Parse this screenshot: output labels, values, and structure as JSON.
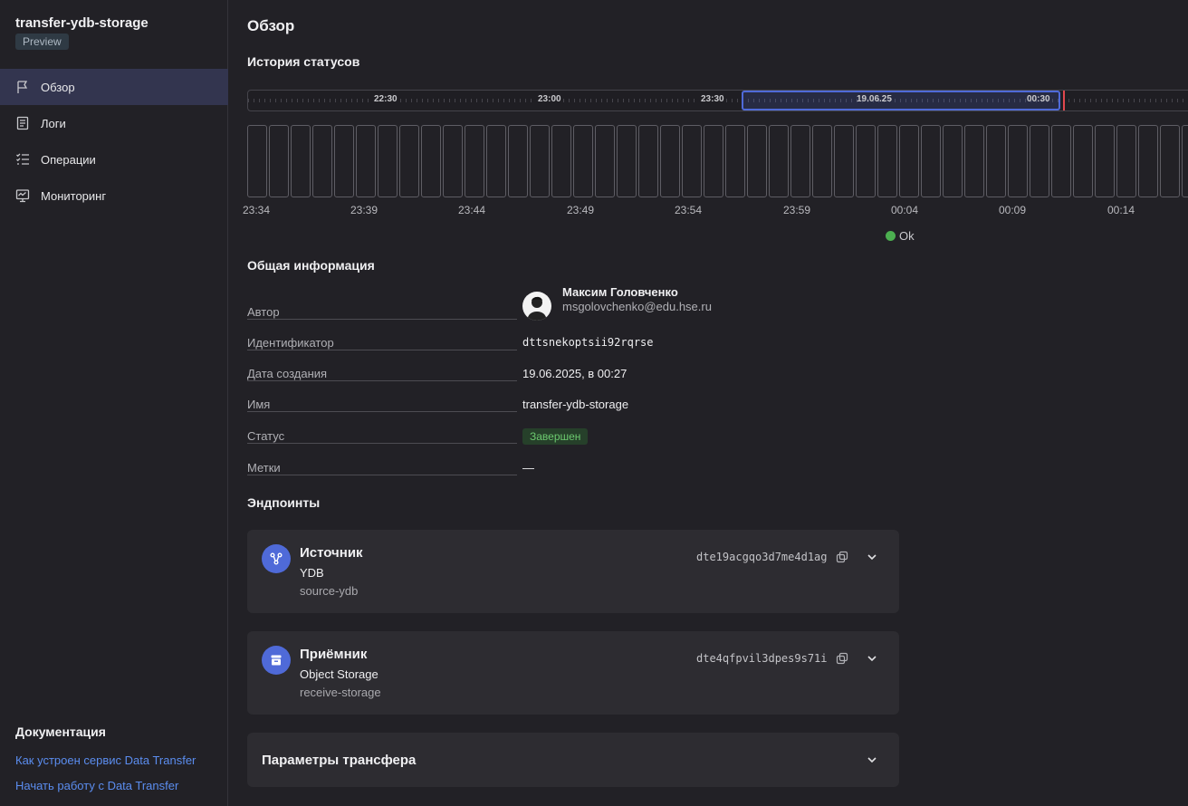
{
  "sidebar": {
    "app_title": "transfer-ydb-storage",
    "badge": "Preview",
    "items": [
      {
        "label": "Обзор",
        "icon": "flag-icon",
        "active": true
      },
      {
        "label": "Логи",
        "icon": "log-icon"
      },
      {
        "label": "Операции",
        "icon": "list-check-icon"
      },
      {
        "label": "Мониторинг",
        "icon": "monitoring-icon"
      }
    ],
    "docs_title": "Документация",
    "docs_links": [
      "Как устроен сервис Data Transfer",
      "Начать работу с Data Transfer"
    ]
  },
  "page": {
    "title": "Обзор",
    "status_history_title": "История статусов",
    "timeline_labels": [
      "22:30",
      "23:00",
      "23:30",
      "19.06.25",
      "00:30"
    ],
    "bar_axis_labels": [
      "23:34",
      "23:39",
      "23:44",
      "23:49",
      "23:54",
      "23:59",
      "00:04",
      "00:09",
      "00:14"
    ],
    "legend_ok": "Ok",
    "general_info_title": "Общая информация",
    "info": {
      "author_label": "Автор",
      "author_name": "Максим Головченко",
      "author_email": "msgolovchenko@edu.hse.ru",
      "id_label": "Идентификатор",
      "id_value": "dttsnekoptsii92rqrse",
      "created_label": "Дата создания",
      "created_value": "19.06.2025, в 00:27",
      "name_label": "Имя",
      "name_value": "transfer-ydb-storage",
      "status_label": "Статус",
      "status_value": "Завершен",
      "tags_label": "Метки",
      "tags_value": "—"
    },
    "endpoints_title": "Эндпоинты",
    "source": {
      "title": "Источник",
      "type": "YDB",
      "name": "source-ydb",
      "id": "dte19acgqo3d7me4d1ag"
    },
    "target": {
      "title": "Приёмник",
      "type": "Object Storage",
      "name": "receive-storage",
      "id": "dte4qfpvil3dpes9s71i"
    },
    "params_title": "Параметры трансфера"
  },
  "colors": {
    "accent": "#4f6ad8",
    "ok": "#4caf50",
    "link": "#5b8def",
    "now_marker": "#e0474e"
  }
}
